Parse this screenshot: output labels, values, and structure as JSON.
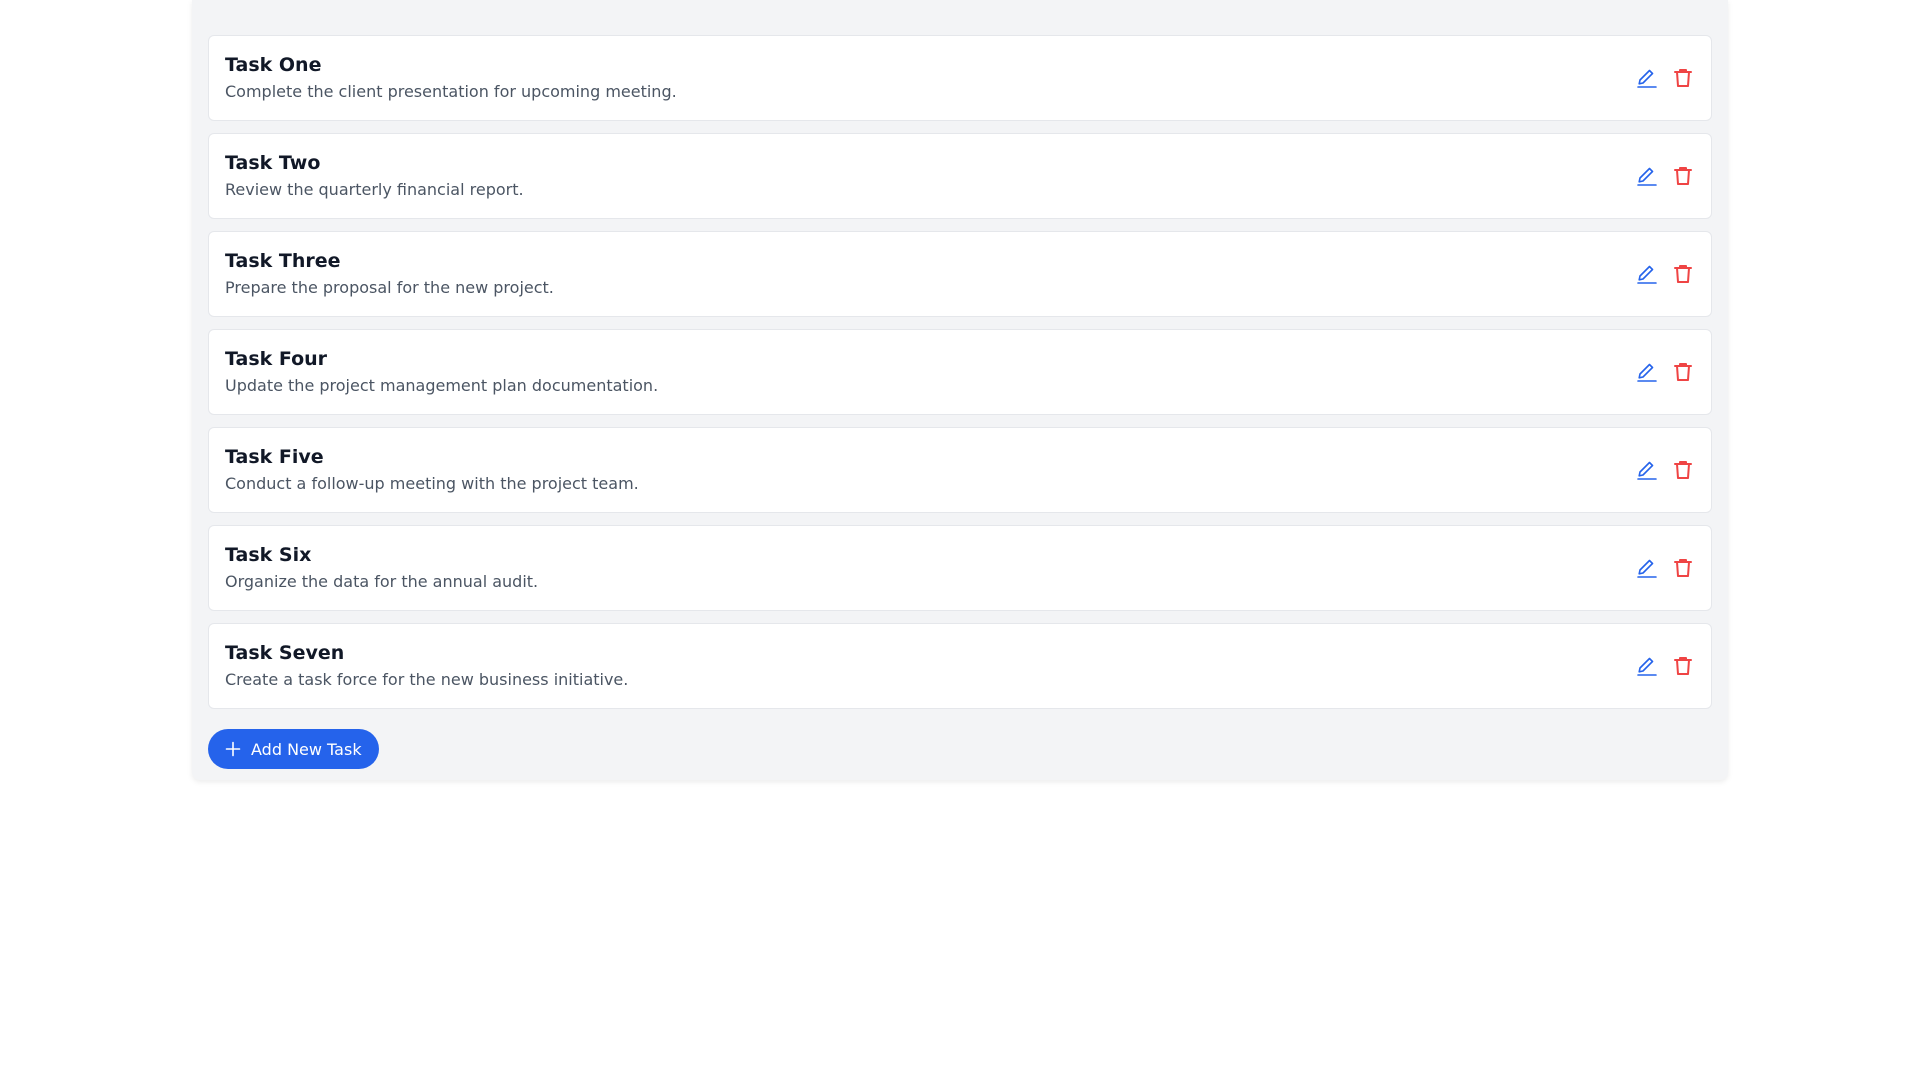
{
  "tasks": [
    {
      "title": "Task One",
      "description": "Complete the client presentation for upcoming meeting."
    },
    {
      "title": "Task Two",
      "description": "Review the quarterly financial report."
    },
    {
      "title": "Task Three",
      "description": "Prepare the proposal for the new project."
    },
    {
      "title": "Task Four",
      "description": "Update the project management plan documentation."
    },
    {
      "title": "Task Five",
      "description": "Conduct a follow-up meeting with the project team."
    },
    {
      "title": "Task Six",
      "description": "Organize the data for the annual audit."
    },
    {
      "title": "Task Seven",
      "description": "Create a task force for the new business initiative."
    }
  ],
  "actions": {
    "edit_icon": "pencil-icon",
    "delete_icon": "trash-icon"
  },
  "add_button": {
    "label": "Add New Task",
    "icon": "plus-icon"
  },
  "colors": {
    "accent": "#2563eb",
    "danger": "#ef4444",
    "title": "#111827",
    "description": "#4b5563",
    "panel_background": "#f3f4f6"
  }
}
